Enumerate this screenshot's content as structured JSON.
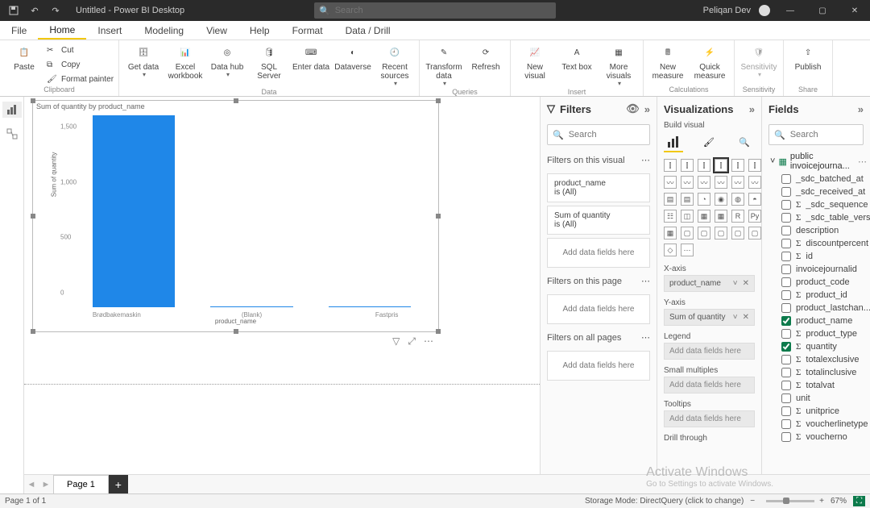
{
  "app": {
    "title": "Untitled - Power BI Desktop",
    "user": "Peliqan Dev",
    "search_placeholder": "Search"
  },
  "ribbon_tabs": [
    "File",
    "Home",
    "Insert",
    "Modeling",
    "View",
    "Help",
    "Format",
    "Data / Drill"
  ],
  "ribbon_active": "Home",
  "ribbon": {
    "clipboard": {
      "label": "Clipboard",
      "paste": "Paste",
      "cut": "Cut",
      "copy": "Copy",
      "format_painter": "Format painter"
    },
    "data": {
      "label": "Data",
      "get_data": "Get data",
      "excel": "Excel workbook",
      "datahub": "Data hub",
      "sql": "SQL Server",
      "enter": "Enter data",
      "dataverse": "Dataverse",
      "recent": "Recent sources"
    },
    "queries": {
      "label": "Queries",
      "transform": "Transform data",
      "refresh": "Refresh"
    },
    "insert": {
      "label": "Insert",
      "new_visual": "New visual",
      "text_box": "Text box",
      "more": "More visuals"
    },
    "calculations": {
      "label": "Calculations",
      "new_measure": "New measure",
      "quick_measure": "Quick measure"
    },
    "sensitivity": {
      "label": "Sensitivity",
      "btn": "Sensitivity"
    },
    "share": {
      "label": "Share",
      "publish": "Publish"
    }
  },
  "page_tab": "Page 1",
  "statusbar": {
    "left": "Page 1 of 1",
    "storage": "Storage Mode: DirectQuery (click to change)",
    "zoom": "67%"
  },
  "watermark": {
    "w1": "Activate Windows",
    "w2": "Go to Settings to activate Windows."
  },
  "filters_pane": {
    "title": "Filters",
    "search_placeholder": "Search",
    "sections": {
      "visual": "Filters on this visual",
      "page": "Filters on this page",
      "all": "Filters on all pages"
    },
    "add_text": "Add data fields here",
    "cards": [
      {
        "name": "product_name",
        "summary": "is (All)"
      },
      {
        "name": "Sum of quantity",
        "summary": "is (All)"
      }
    ]
  },
  "viz_pane": {
    "title": "Visualizations",
    "build": "Build visual",
    "wells": {
      "x": {
        "label": "X-axis",
        "value": "product_name"
      },
      "y": {
        "label": "Y-axis",
        "value": "Sum of quantity"
      },
      "legend": {
        "label": "Legend",
        "placeholder": "Add data fields here"
      },
      "small": {
        "label": "Small multiples",
        "placeholder": "Add data fields here"
      },
      "tooltips": {
        "label": "Tooltips",
        "placeholder": "Add data fields here"
      },
      "drill": {
        "label": "Drill through"
      }
    }
  },
  "fields_pane": {
    "title": "Fields",
    "search_placeholder": "Search",
    "table": "public invoicejourna...",
    "fields": [
      {
        "name": "_sdc_batched_at",
        "checked": false,
        "sigma": false
      },
      {
        "name": "_sdc_received_at",
        "checked": false,
        "sigma": false
      },
      {
        "name": "_sdc_sequence",
        "checked": false,
        "sigma": true
      },
      {
        "name": "_sdc_table_version",
        "checked": false,
        "sigma": true
      },
      {
        "name": "description",
        "checked": false,
        "sigma": false
      },
      {
        "name": "discountpercent",
        "checked": false,
        "sigma": true
      },
      {
        "name": "id",
        "checked": false,
        "sigma": true
      },
      {
        "name": "invoicejournalid",
        "checked": false,
        "sigma": false
      },
      {
        "name": "product_code",
        "checked": false,
        "sigma": false
      },
      {
        "name": "product_id",
        "checked": false,
        "sigma": true
      },
      {
        "name": "product_lastchan...",
        "checked": false,
        "sigma": false
      },
      {
        "name": "product_name",
        "checked": true,
        "sigma": false
      },
      {
        "name": "product_type",
        "checked": false,
        "sigma": true
      },
      {
        "name": "quantity",
        "checked": true,
        "sigma": true
      },
      {
        "name": "totalexclusive",
        "checked": false,
        "sigma": true
      },
      {
        "name": "totalinclusive",
        "checked": false,
        "sigma": true
      },
      {
        "name": "totalvat",
        "checked": false,
        "sigma": true
      },
      {
        "name": "unit",
        "checked": false,
        "sigma": false
      },
      {
        "name": "unitprice",
        "checked": false,
        "sigma": true
      },
      {
        "name": "voucherlinetype",
        "checked": false,
        "sigma": true
      },
      {
        "name": "voucherno",
        "checked": false,
        "sigma": true
      }
    ]
  },
  "chart_data": {
    "type": "bar",
    "title": "Sum of quantity by product_name",
    "xlabel": "product_name",
    "ylabel": "Sum of quantity",
    "ylim": [
      0,
      1600
    ],
    "yticks": [
      0,
      500,
      1000,
      1500
    ],
    "categories": [
      "Brødbakemaskin",
      "(Blank)",
      "Fastpris"
    ],
    "values": [
      1600,
      10,
      10
    ]
  }
}
